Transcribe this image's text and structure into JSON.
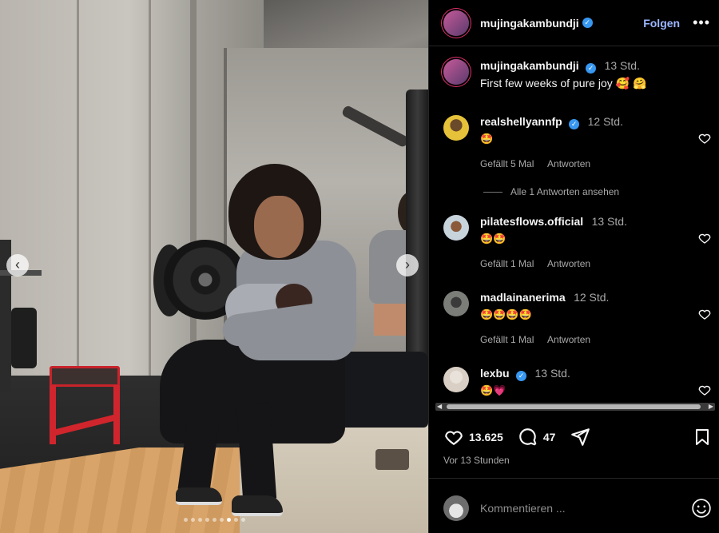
{
  "post": {
    "username": "mujingakambundji",
    "follow_label": "Folgen",
    "more_label": "•••",
    "caption_time": "13 Std.",
    "caption_text": "First few weeks of pure joy",
    "caption_emojis": "🥰 🤗"
  },
  "comments": [
    {
      "username": "realshellyannfp",
      "verified": true,
      "time": "12 Std.",
      "text": "🤩",
      "likes": "Gefällt 5 Mal",
      "reply_label": "Antworten",
      "view_replies": "Alle 1 Antworten ansehen"
    },
    {
      "username": "pilatesflows.official",
      "verified": false,
      "time": "13 Std.",
      "text": "🤩🤩",
      "likes": "Gefällt 1 Mal",
      "reply_label": "Antworten"
    },
    {
      "username": "madlainanerima",
      "verified": false,
      "time": "12 Std.",
      "text": "🤩🤩🤩🤩",
      "likes": "Gefällt 1 Mal",
      "reply_label": "Antworten"
    },
    {
      "username": "lexbu",
      "verified": true,
      "time": "13 Std.",
      "text": "🤩💗"
    }
  ],
  "actions": {
    "like_count": "13.625",
    "comment_count": "47",
    "posted_ago": "Vor 13 Stunden"
  },
  "comment_box": {
    "placeholder": "Kommentieren ..."
  },
  "icons": {
    "like": "heart-icon",
    "comment": "comment-bubble-icon",
    "share": "paper-plane-icon",
    "save": "bookmark-icon",
    "emoji": "smiley-icon"
  },
  "colors": {
    "background": "#000000",
    "link": "#9cb7ff",
    "verified": "#3897f0",
    "muted": "#a8a8a8"
  },
  "carousel": {
    "prev_label": "‹",
    "next_label": "›",
    "slides": 9,
    "active_slide": 7
  }
}
